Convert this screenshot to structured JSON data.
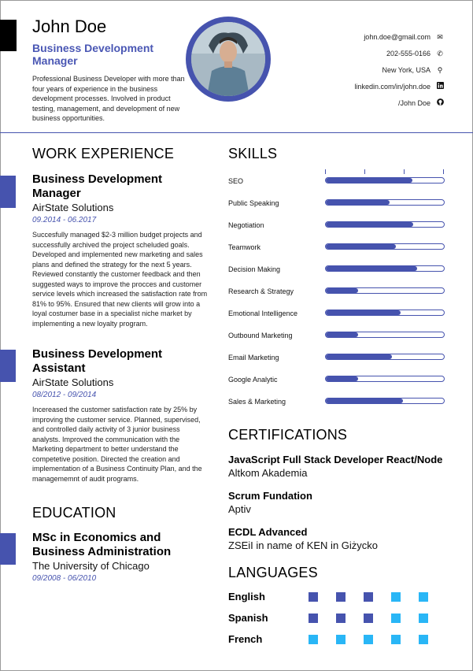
{
  "header": {
    "name": "John Doe",
    "title": "Business Development Manager",
    "summary": "Professional Business Developer with more than four years of experience in the business development processes. Involved in product testing, management, and development of new business opportunities."
  },
  "contact": [
    {
      "text": "john.doe@gmail.com",
      "icon": "envelope-icon"
    },
    {
      "text": "202-555-0166",
      "icon": "phone-icon"
    },
    {
      "text": "New York, USA",
      "icon": "map-pin-icon"
    },
    {
      "text": "linkedin.com/in/john.doe",
      "icon": "linkedin-icon"
    },
    {
      "text": "/John Doe",
      "icon": "github-icon"
    }
  ],
  "sections": {
    "work": "WORK EXPERIENCE",
    "education": "EDUCATION",
    "skills": "SKILLS",
    "certifications": "CERTIFICATIONS",
    "languages": "LANGUAGES"
  },
  "work": [
    {
      "title": "Business Development Manager",
      "company": "AirState Solutions",
      "dates": "09.2014 - 06.2017",
      "description": "Succesfully managed $2-3 million budget projects and successfully archived the project scheluded goals. Developed and implemented new marketing and sales plans and defined the strategy for the next 5 years. Reviewed constantly the customer feedback and then suggested ways to improve the procces and customer service levels which increased the satisfaction rate from 81% to 95%. Ensured that new clients will grow into a loyal costumer base in a specialist niche market by implementing a new loyalty program."
    },
    {
      "title": "Business Development Assistant",
      "company": "AirState Solutions",
      "dates": "08/2012 - 09/2014",
      "description": "Incereased the customer satisfaction rate by 25% by improving the customer service. Planned, supervised, and controlled daily activity of 3 junior business analysts. Improved the communication with the Marketing department to better understand the competetive position. Directed the creation and implementation of a Business Continuity Plan, and the managememnt of audit programs."
    }
  ],
  "education": [
    {
      "degree": "MSc in Economics and Business Administration",
      "school": "The University of Chicago",
      "dates": "09/2008 - 06/2010"
    }
  ],
  "skills": [
    {
      "name": "SEO",
      "level": 0.73
    },
    {
      "name": "Public Speaking",
      "level": 0.54
    },
    {
      "name": "Negotiation",
      "level": 0.74
    },
    {
      "name": "Teamwork",
      "level": 0.59
    },
    {
      "name": "Decision Making",
      "level": 0.77
    },
    {
      "name": "Research & Strategy",
      "level": 0.27
    },
    {
      "name": "Emotional Intelligence",
      "level": 0.63
    },
    {
      "name": "Outbound Marketing",
      "level": 0.27
    },
    {
      "name": "Email Marketing",
      "level": 0.56
    },
    {
      "name": "Google Analytic",
      "level": 0.27
    },
    {
      "name": "Sales & Marketing",
      "level": 0.65
    }
  ],
  "certifications": [
    {
      "title": "JavaScript Full Stack Developer React/Node",
      "org": "Altkom Akademia"
    },
    {
      "title": "Scrum Fundation",
      "org": "Aptiv"
    },
    {
      "title": "ECDL Advanced",
      "org": "ZSEiI in name of KEN in Giżycko"
    }
  ],
  "languages": [
    {
      "name": "English",
      "level": 3,
      "max": 5
    },
    {
      "name": "Spanish",
      "level": 3,
      "max": 5
    },
    {
      "name": "French",
      "level": 0,
      "max": 5
    }
  ],
  "colors": {
    "accent": "#4653ae",
    "dot_light": "#29b6f6",
    "black": "#000000"
  }
}
